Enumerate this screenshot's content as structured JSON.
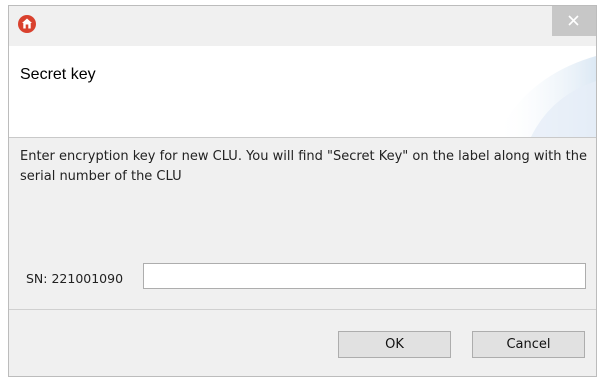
{
  "window": {
    "icon": "home-app-icon",
    "close_icon": "close-icon"
  },
  "banner": {
    "title": "Secret key"
  },
  "message": "Enter encryption key for new CLU. You will find \"Secret Key\" on the label along with the serial number of the CLU",
  "serial": {
    "label": "SN: 221001090",
    "value": "",
    "placeholder": ""
  },
  "buttons": {
    "ok_label": "OK",
    "cancel_label": "Cancel"
  },
  "colors": {
    "icon_red": "#d9412e",
    "close_bg": "#c7c7c7"
  }
}
